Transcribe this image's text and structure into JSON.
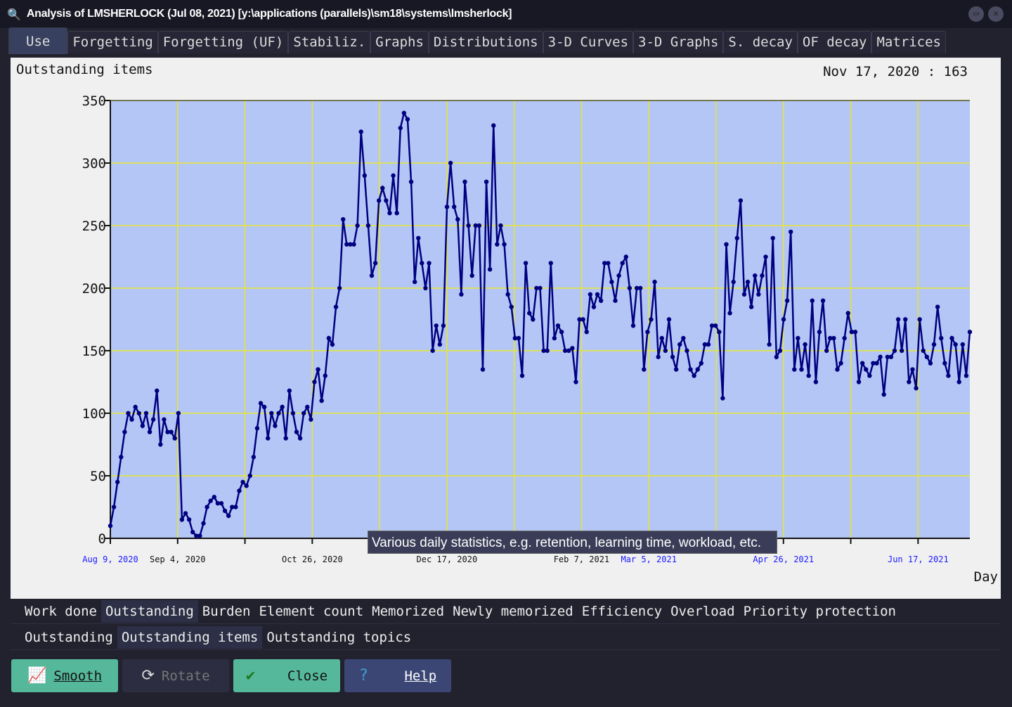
{
  "window": {
    "title": "Analysis of LMSHERLOCK (Jul 08, 2021) [y:\\applications (parallels)\\sm18\\systems\\lmsherlock]"
  },
  "tabs": [
    "Use",
    "Forgetting",
    "Forgetting (UF)",
    "Stabiliz.",
    "Graphs",
    "Distributions",
    "3-D Curves",
    "3-D Graphs",
    "S. decay",
    "OF decay",
    "Matrices"
  ],
  "chart_header": {
    "title": "Outstanding items",
    "readout": "Nov 17, 2020 : 163"
  },
  "tooltip": "Various daily statistics, e.g. retention, learning time, workload, etc.",
  "categories_row": [
    "Work done",
    "Outstanding",
    "Burden",
    "Element count",
    "Memorized",
    "Newly memorized",
    "Efficiency",
    "Overload",
    "Priority protection"
  ],
  "subcategories_row": [
    "Outstanding",
    "Outstanding items",
    "Outstanding topics"
  ],
  "buttons": {
    "smooth": "Smooth",
    "rotate": "Rotate",
    "close": "Close",
    "help": "Help"
  },
  "colors": {
    "plot_bg": "#b4c6f5",
    "grid": "#e6e632",
    "line": "#000080",
    "highlight_tick": "#1a1aff"
  },
  "chart_data": {
    "type": "line",
    "title": "Outstanding items",
    "xlabel": "Day",
    "ylabel": "",
    "ylim": [
      0,
      350
    ],
    "yticks": [
      0,
      50,
      100,
      150,
      200,
      250,
      300,
      350
    ],
    "xlim_days": [
      0,
      332
    ],
    "x_start": "Aug 9, 2020",
    "xticks": [
      {
        "day": 0,
        "label": "Aug 9, 2020",
        "highlight": true
      },
      {
        "day": 26,
        "label": "Sep 4, 2020",
        "highlight": false
      },
      {
        "day": 78,
        "label": "Oct 26, 2020",
        "highlight": false
      },
      {
        "day": 130,
        "label": "Dec 17, 2020",
        "highlight": false
      },
      {
        "day": 182,
        "label": "Feb 7, 2021",
        "highlight": false
      },
      {
        "day": 208,
        "label": "Mar 5, 2021",
        "highlight": true
      },
      {
        "day": 260,
        "label": "Apr 26, 2021",
        "highlight": true
      },
      {
        "day": 312,
        "label": "Jun 17, 2021",
        "highlight": true
      }
    ],
    "grid_step_days": 26,
    "values": [
      10,
      25,
      45,
      65,
      85,
      100,
      95,
      105,
      100,
      90,
      100,
      85,
      95,
      118,
      75,
      95,
      85,
      85,
      80,
      100,
      15,
      20,
      15,
      5,
      2,
      2,
      12,
      25,
      30,
      33,
      28,
      28,
      22,
      18,
      25,
      25,
      38,
      45,
      42,
      50,
      65,
      88,
      108,
      105,
      80,
      100,
      90,
      100,
      105,
      80,
      118,
      100,
      85,
      80,
      100,
      105,
      95,
      125,
      135,
      110,
      130,
      160,
      155,
      185,
      200,
      255,
      235,
      235,
      235,
      250,
      325,
      290,
      250,
      210,
      220,
      270,
      280,
      270,
      260,
      290,
      260,
      328,
      340,
      335,
      285,
      205,
      240,
      220,
      200,
      220,
      150,
      170,
      155,
      170,
      265,
      300,
      265,
      255,
      195,
      285,
      250,
      210,
      250,
      250,
      135,
      285,
      215,
      330,
      235,
      250,
      235,
      195,
      185,
      160,
      160,
      130,
      220,
      180,
      175,
      200,
      200,
      150,
      150,
      220,
      160,
      170,
      165,
      150,
      150,
      152,
      125,
      175,
      175,
      165,
      195,
      185,
      195,
      190,
      220,
      220,
      205,
      190,
      210,
      220,
      225,
      200,
      170,
      200,
      200,
      135,
      165,
      175,
      205,
      145,
      160,
      150,
      175,
      145,
      135,
      155,
      160,
      150,
      135,
      130,
      135,
      140,
      155,
      155,
      170,
      170,
      165,
      112,
      235,
      180,
      205,
      240,
      270,
      195,
      205,
      185,
      210,
      195,
      210,
      225,
      155,
      240,
      145,
      150,
      175,
      190,
      245,
      135,
      160,
      135,
      155,
      130,
      190,
      125,
      165,
      190,
      150,
      160,
      160,
      135,
      140,
      160,
      180,
      165,
      165,
      125,
      140,
      135,
      130,
      140,
      140,
      145,
      115,
      145,
      145,
      150,
      175,
      150,
      175,
      125,
      135,
      120,
      175,
      150,
      145,
      140,
      155,
      185,
      160,
      140,
      130,
      160,
      155,
      125,
      155,
      130,
      165
    ]
  }
}
